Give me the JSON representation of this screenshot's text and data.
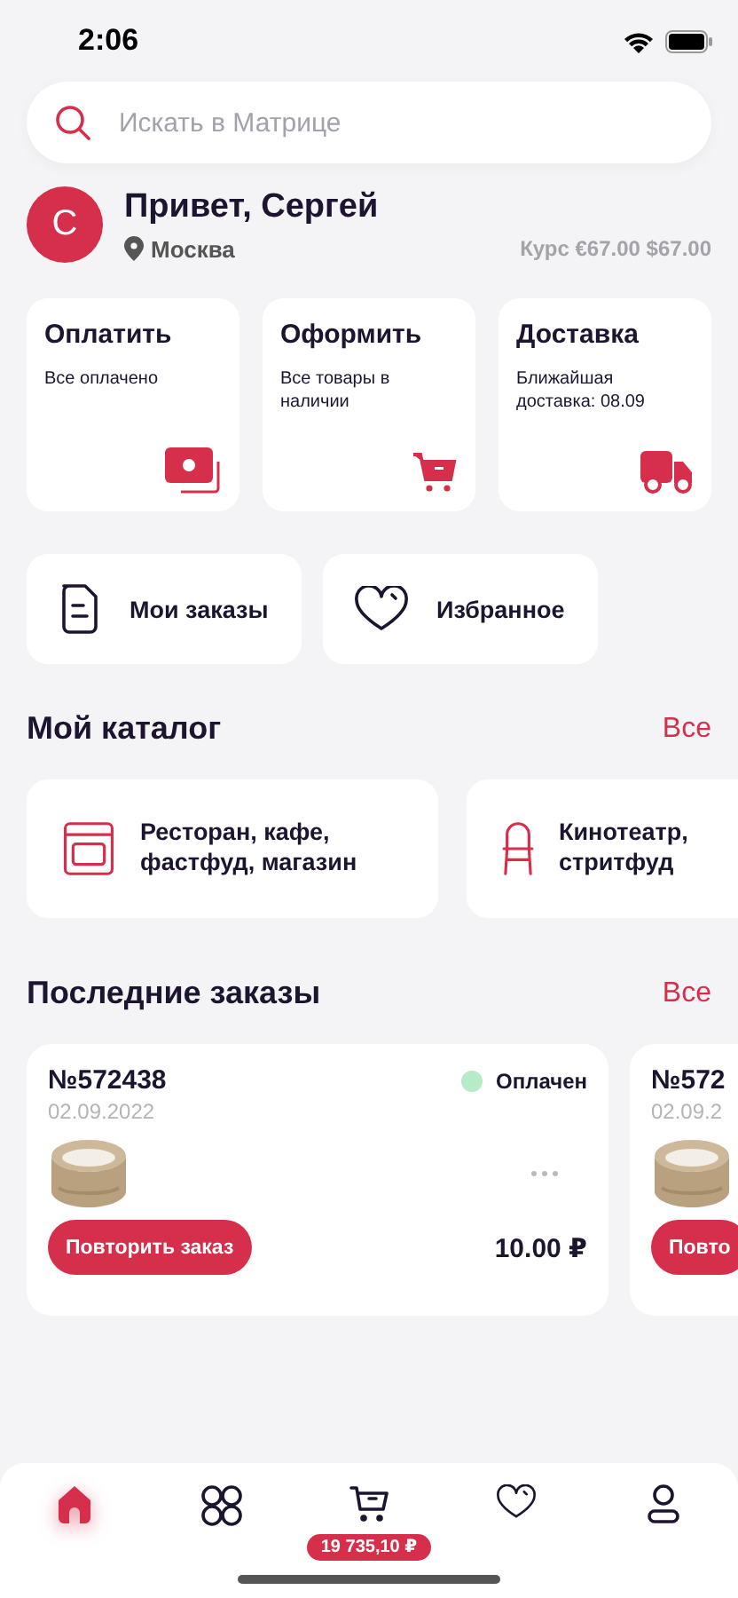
{
  "status_bar": {
    "time": "2:06"
  },
  "search": {
    "placeholder": "Искать в Матрице"
  },
  "profile": {
    "avatar": "С",
    "greeting": "Привет, Сергей",
    "city": "Москва",
    "rate": "Курс €67.00 $67.00"
  },
  "quick_cards": [
    {
      "kind": "payment",
      "title": "Оплатить",
      "subtitle": "Все оплачено"
    },
    {
      "kind": "cart",
      "title": "Оформить",
      "subtitle": "Все товары в наличии"
    },
    {
      "kind": "delivery",
      "title": "Доставка",
      "subtitle": "Ближайшая доставка: 08.09"
    }
  ],
  "shortcuts": [
    {
      "kind": "orders",
      "label": "Мои заказы"
    },
    {
      "kind": "favorites",
      "label": "Избранное"
    }
  ],
  "catalog": {
    "title": "Мой каталог",
    "all": "Все",
    "items": [
      {
        "kind": "oven",
        "label": "Ресторан, кафе, фастфуд, магазин"
      },
      {
        "kind": "chair",
        "label": "Кинотеатр, стритфуд"
      }
    ]
  },
  "orders": {
    "title": "Последние заказы",
    "all": "Все",
    "items": [
      {
        "number": "№572438",
        "date": "02.09.2022",
        "status": "Оплачен",
        "color": "#b6ebc8",
        "button": "Повторить заказ",
        "total": "10.00 ₽"
      },
      {
        "number": "№572",
        "date": "02.09.2",
        "button": "Повто"
      }
    ]
  },
  "nav": [
    {
      "kind": "home",
      "selected": true
    },
    {
      "kind": "catalog",
      "selected": false
    },
    {
      "kind": "cart",
      "selected": false,
      "badge": "19 735,10 ₽"
    },
    {
      "kind": "favorites",
      "selected": false
    },
    {
      "kind": "profile",
      "selected": false
    }
  ]
}
